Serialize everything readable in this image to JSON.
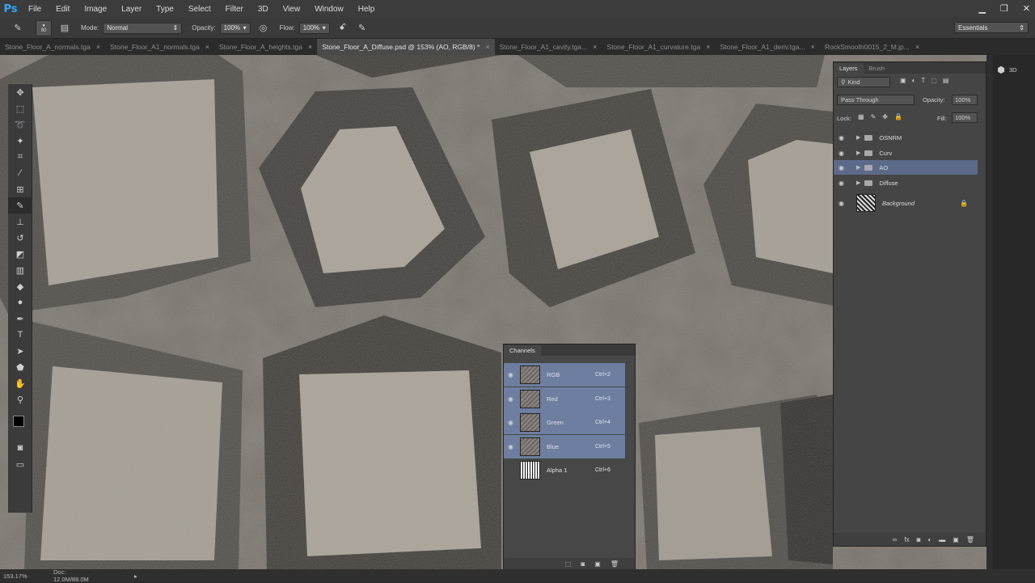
{
  "app": {
    "logo": "Ps"
  },
  "menu": [
    "File",
    "Edit",
    "Image",
    "Layer",
    "Type",
    "Select",
    "Filter",
    "3D",
    "View",
    "Window",
    "Help"
  ],
  "window_controls": {
    "minimize": "▁",
    "restore": "❐",
    "close": "✕"
  },
  "options_bar": {
    "brush_size": "80",
    "mode_label": "Mode:",
    "mode_value": "Normal",
    "opacity_label": "Opacity:",
    "opacity_value": "100%",
    "flow_label": "Flow:",
    "flow_value": "100%",
    "workspace": "Essentials"
  },
  "tabs": [
    {
      "label": "Stone_Floor_A_normals.tga",
      "active": false
    },
    {
      "label": "Stone_Floor_A1_normals.tga",
      "active": false
    },
    {
      "label": "Stone_Floor_A_heights.tga",
      "active": false
    },
    {
      "label": "Stone_Floor_A_Diffuse.psd @ 153% (AO, RGB/8) *",
      "active": true
    },
    {
      "label": "Stone_Floor_A1_cavity.tga...",
      "active": false
    },
    {
      "label": "Stone_Floor_A1_curvature.tga",
      "active": false
    },
    {
      "label": "Stone_Floor_A1_deriv.tga...",
      "active": false
    },
    {
      "label": "RockSmooth0015_2_M.jp...",
      "active": false
    }
  ],
  "status": {
    "zoom": "153.17%",
    "doc": "Doc: 12.0M/88.0M"
  },
  "layers_panel": {
    "tabs": [
      "Layers",
      "Brush"
    ],
    "kind_label": "Kind",
    "blend_mode": "Pass Through",
    "opacity_label": "Opacity:",
    "opacity_value": "100%",
    "lock_label": "Lock:",
    "fill_label": "Fill:",
    "fill_value": "100%",
    "layers": [
      {
        "name": "OSNRM",
        "type": "group",
        "selected": false
      },
      {
        "name": "Curv",
        "type": "group",
        "selected": false
      },
      {
        "name": "AO",
        "type": "group",
        "selected": true
      },
      {
        "name": "Diffuse",
        "type": "group",
        "selected": false
      },
      {
        "name": "Background",
        "type": "image",
        "selected": false
      }
    ]
  },
  "channels_panel": {
    "title": "Channels",
    "channels": [
      {
        "name": "RGB",
        "shortcut": "Ctrl+2",
        "selected": true
      },
      {
        "name": "Red",
        "shortcut": "Ctrl+3",
        "selected": true
      },
      {
        "name": "Green",
        "shortcut": "Ctrl+4",
        "selected": true
      },
      {
        "name": "Blue",
        "shortcut": "Ctrl+5",
        "selected": true
      },
      {
        "name": "Alpha 1",
        "shortcut": "Ctrl+6",
        "selected": false
      }
    ]
  },
  "colors": {
    "selection_blue": "#5c6a8a",
    "channel_selection": "#6d7ea0",
    "ps_blue": "#31a8ff"
  }
}
